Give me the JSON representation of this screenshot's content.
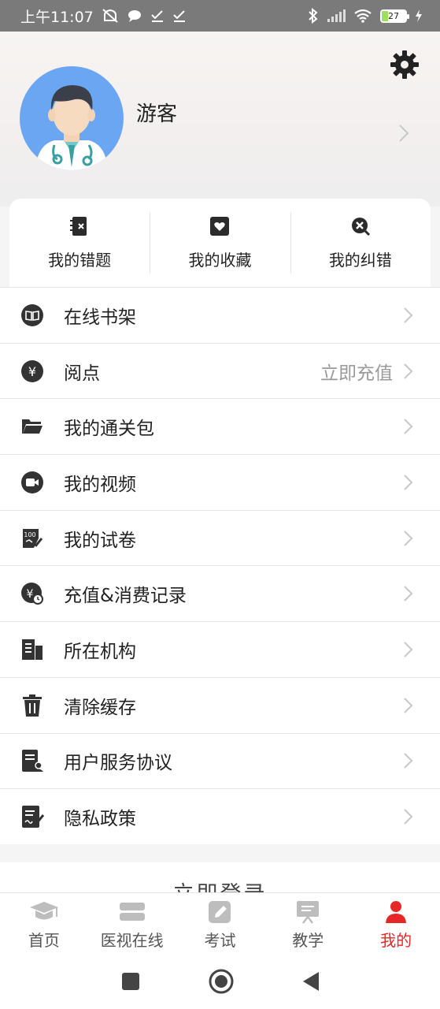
{
  "status_bar": {
    "time": "上午11:07",
    "battery": "27"
  },
  "profile": {
    "username": "游客"
  },
  "quick_actions": [
    {
      "label": "我的错题",
      "icon": "notebook-x-icon"
    },
    {
      "label": "我的收藏",
      "icon": "heart-box-icon"
    },
    {
      "label": "我的纠错",
      "icon": "x-circle-icon"
    }
  ],
  "menu": [
    {
      "label": "在线书架",
      "icon": "book-icon",
      "extra": ""
    },
    {
      "label": "阅点",
      "icon": "yen-coin-icon",
      "extra": "立即充值"
    },
    {
      "label": "我的通关包",
      "icon": "folder-icon",
      "extra": ""
    },
    {
      "label": "我的视频",
      "icon": "video-camera-icon",
      "extra": ""
    },
    {
      "label": "我的试卷",
      "icon": "exam-paper-icon",
      "extra": ""
    },
    {
      "label": "充值&消费记录",
      "icon": "recharge-record-icon",
      "extra": ""
    },
    {
      "label": "所在机构",
      "icon": "building-icon",
      "extra": ""
    },
    {
      "label": "清除缓存",
      "icon": "trash-icon",
      "extra": ""
    },
    {
      "label": "用户服务协议",
      "icon": "agreement-doc-icon",
      "extra": ""
    },
    {
      "label": "隐私政策",
      "icon": "privacy-doc-icon",
      "extra": ""
    }
  ],
  "login_button": "立即登录",
  "tabs": [
    {
      "label": "首页",
      "icon": "graduation-cap-icon",
      "active": false
    },
    {
      "label": "医视在线",
      "icon": "layers-icon",
      "active": false
    },
    {
      "label": "考试",
      "icon": "pencil-icon",
      "active": false
    },
    {
      "label": "教学",
      "icon": "presentation-icon",
      "active": false
    },
    {
      "label": "我的",
      "icon": "person-icon",
      "active": true
    }
  ],
  "colors": {
    "accent": "#e62727",
    "status_bar": "#7a7a7a",
    "avatar_bg": "#6aa6f2"
  }
}
